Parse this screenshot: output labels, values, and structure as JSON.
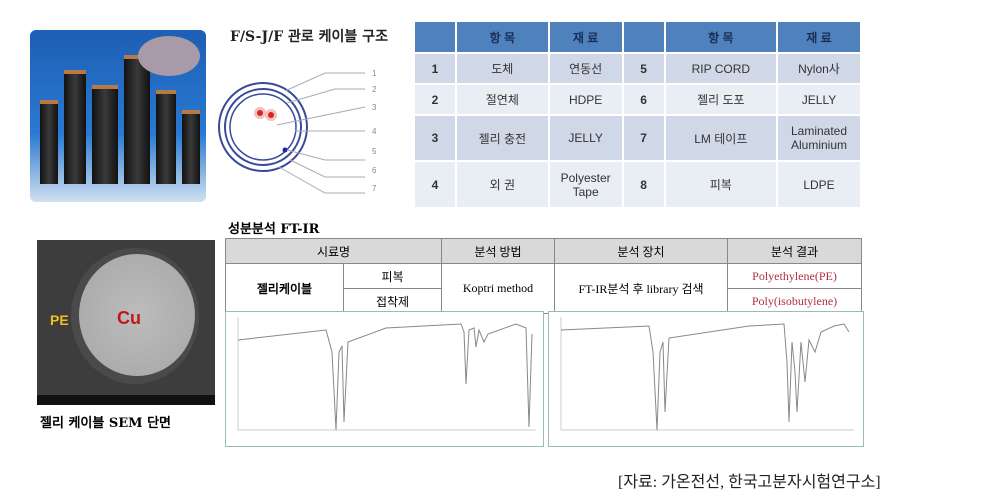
{
  "diagram": {
    "title": "F/S-J/F 관로 케이블 구조",
    "labels": [
      "1",
      "2",
      "3",
      "4",
      "5",
      "6",
      "7"
    ]
  },
  "materials": {
    "headers": [
      "",
      "항 목",
      "재 료",
      "",
      "항 목",
      "재 료"
    ],
    "rows": [
      [
        "1",
        "도체",
        "연동선",
        "5",
        "RIP CORD",
        "Nylon사"
      ],
      [
        "2",
        "절연체",
        "HDPE",
        "6",
        "젤리 도포",
        "JELLY"
      ],
      [
        "3",
        "젤리 충전",
        "JELLY",
        "7",
        "LM 테이프",
        "Laminated Aluminium"
      ],
      [
        "4",
        "외 권",
        "Polyester Tape",
        "8",
        "피복",
        "LDPE"
      ]
    ]
  },
  "ftir": {
    "title": "성분분석 FT-IR",
    "headers": [
      "시료명",
      "분석 방법",
      "분석 장치",
      "분석 결과"
    ],
    "sample": "젤리케이블",
    "parts": [
      "피복",
      "접착제"
    ],
    "method": "Koptri method",
    "device": "FT-IR분석 후 library 검색",
    "results": [
      "Polyethylene(PE)",
      "Poly(isobutylene)"
    ],
    "result_color": "#b03040"
  },
  "sem": {
    "labels": [
      "PE",
      "Cu"
    ],
    "caption": "젤리 케이블 SEM 단면"
  },
  "source": "[자료: 가온전선, 한국고분자시험연구소]"
}
